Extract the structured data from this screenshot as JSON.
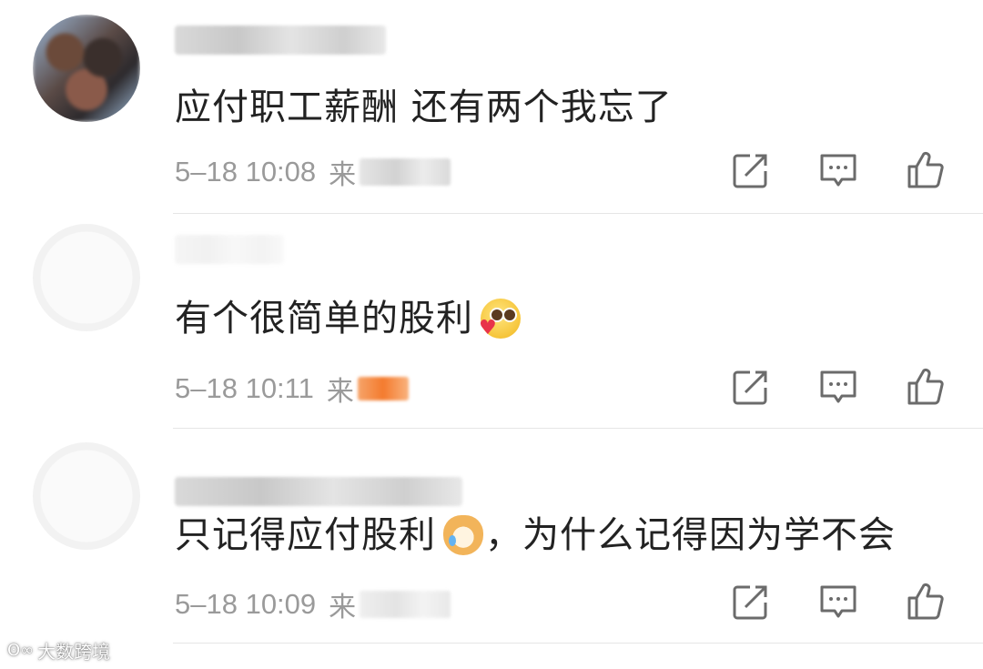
{
  "comments": [
    {
      "text": "应付职工薪酬 还有两个我忘了",
      "time": "5–18 10:08",
      "source_prefix": "来"
    },
    {
      "text": "有个很简单的股利",
      "emoji": "heart-eyes-emoji",
      "time": "5–18 10:11",
      "source_prefix": "来"
    },
    {
      "text_before": "只记得应付股利",
      "emoji": "crying-dog-emoji",
      "text_after": "，为什么记得因为学不会",
      "time": "5–18 10:09",
      "source_prefix": "来"
    }
  ],
  "actions": [
    "share-icon",
    "reply-icon",
    "like-icon"
  ],
  "watermark": "大数跨境",
  "colors": {
    "text": "#222222",
    "meta": "#9a9a9a",
    "icon": "#6b6b6b",
    "divider": "#e6e6e6",
    "emoji_yellow": "#f6c53a"
  }
}
